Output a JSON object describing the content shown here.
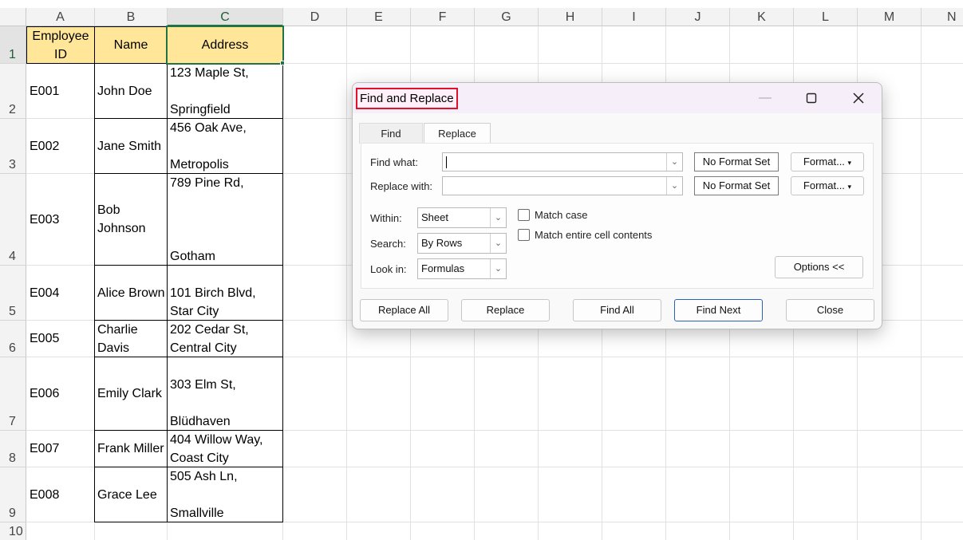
{
  "sheet": {
    "columns": [
      "A",
      "B",
      "C",
      "D",
      "E",
      "F",
      "G",
      "H",
      "I",
      "J",
      "K",
      "L",
      "M",
      "N"
    ],
    "rows": [
      "1",
      "2",
      "3",
      "4",
      "5",
      "6",
      "7",
      "8",
      "9",
      "10"
    ],
    "headers": {
      "employee_id": "Employee\nID",
      "name": "Name",
      "address": "Address"
    },
    "records": [
      {
        "id": "E001",
        "name": "John Doe",
        "addr1": "123 Maple St,",
        "addr2": "Springfield"
      },
      {
        "id": "E002",
        "name": "Jane Smith",
        "addr1": "456 Oak Ave,",
        "addr2": " Metropolis"
      },
      {
        "id": "E003",
        "name": "Bob\nJohnson",
        "addr1": "789 Pine Rd,",
        "addr2": " Gotham"
      },
      {
        "id": "E004",
        "name": "Alice Brown",
        "addr1": "101 Birch Blvd,",
        "addr2": " Star City"
      },
      {
        "id": "E005",
        "name": "Charlie\nDavis",
        "addr1": "202 Cedar St,",
        "addr2": "Central City"
      },
      {
        "id": "E006",
        "name": "Emily Clark",
        "addr1": "303 Elm St,",
        "addr2": "Blüdhaven"
      },
      {
        "id": "E007",
        "name": "Frank Miller",
        "addr1": "404 Willow Way,",
        "addr2": "Coast City"
      },
      {
        "id": "E008",
        "name": "Grace Lee",
        "addr1": "505 Ash Ln,",
        "addr2": " Smallville"
      }
    ]
  },
  "dialog": {
    "title": "Find and Replace",
    "tabs": {
      "find": "Find",
      "replace": "Replace"
    },
    "find_what_label": "Find what:",
    "replace_with_label": "Replace with:",
    "find_what_value": "",
    "replace_with_value": "",
    "no_format": "No Format Set",
    "format_btn": "Format...",
    "within_label": "Within:",
    "within_value": "Sheet",
    "search_label": "Search:",
    "search_value": "By Rows",
    "lookin_label": "Look in:",
    "lookin_value": "Formulas",
    "match_case": "Match case",
    "match_entire": "Match entire cell contents",
    "options_btn": "Options <<",
    "buttons": {
      "replace_all": "Replace All",
      "replace": "Replace",
      "find_all": "Find All",
      "find_next": "Find Next",
      "close": "Close"
    }
  }
}
